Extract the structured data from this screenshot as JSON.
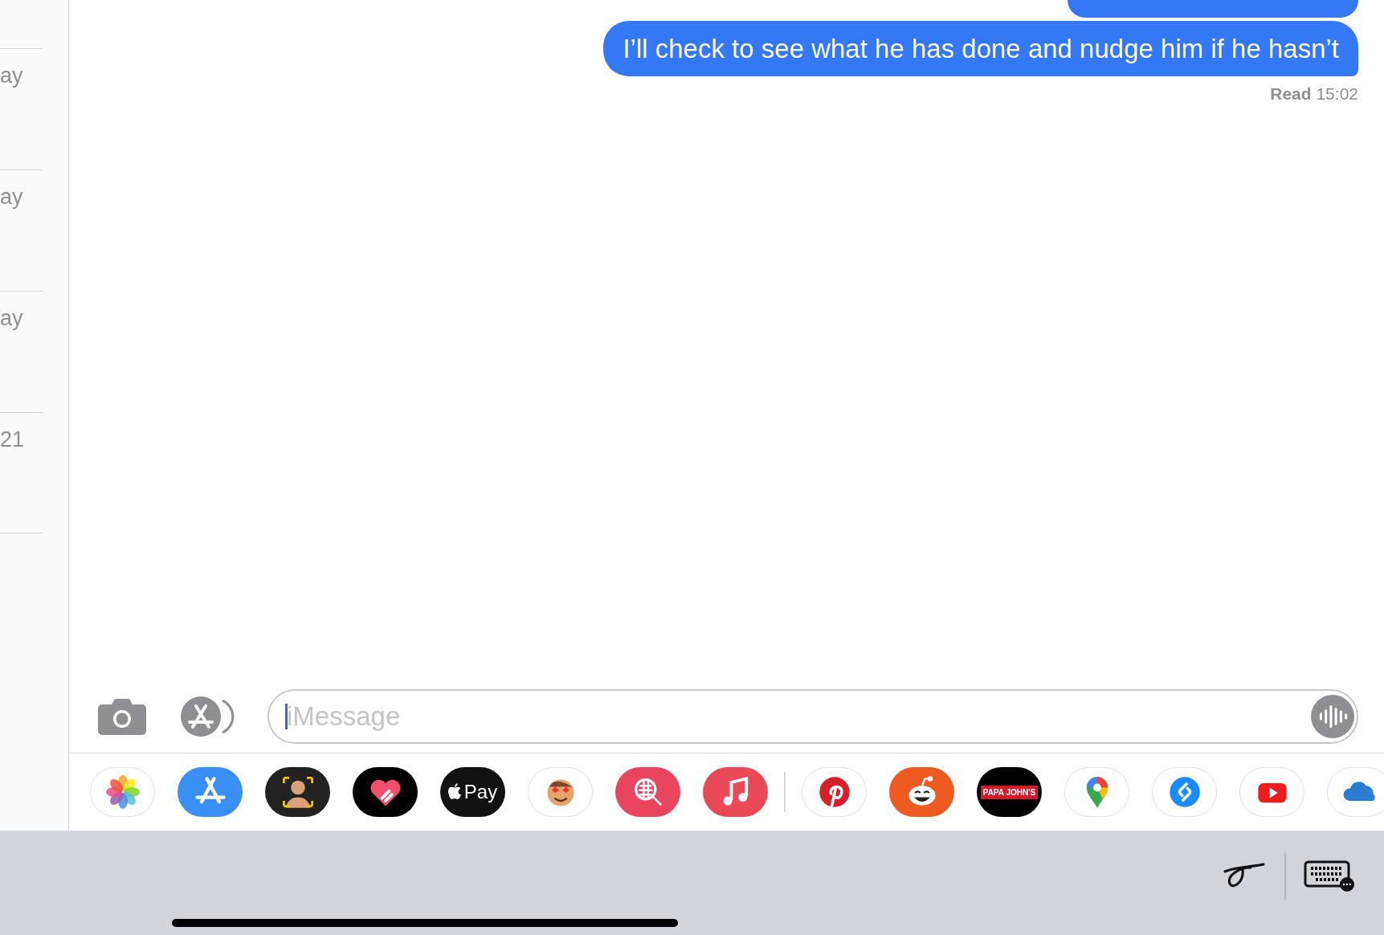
{
  "sidebar": {
    "items": [
      {
        "time": "ay"
      },
      {
        "time": "ay"
      },
      {
        "time": "ay"
      },
      {
        "time": "21"
      }
    ]
  },
  "messages": [
    {
      "kind": "cut"
    },
    {
      "kind": "sent",
      "text": "I’ll check to see what he has done and nudge him if he hasn’t"
    }
  ],
  "receipt": {
    "label": "Read",
    "time": "15:02"
  },
  "composer": {
    "placeholder": "iMessage"
  },
  "apps_left": [
    {
      "kind": "photos"
    },
    {
      "kind": "appstore"
    },
    {
      "kind": "memoji"
    },
    {
      "kind": "touch"
    },
    {
      "kind": "pay",
      "label": "Pay"
    },
    {
      "kind": "stickers"
    },
    {
      "kind": "search"
    },
    {
      "kind": "music"
    }
  ],
  "apps_right": [
    {
      "kind": "pinterest"
    },
    {
      "kind": "reddit"
    },
    {
      "kind": "pizza",
      "label": "PAPA JOHN'S"
    },
    {
      "kind": "maps"
    },
    {
      "kind": "shazam"
    },
    {
      "kind": "youtube"
    },
    {
      "kind": "cloud"
    }
  ]
}
